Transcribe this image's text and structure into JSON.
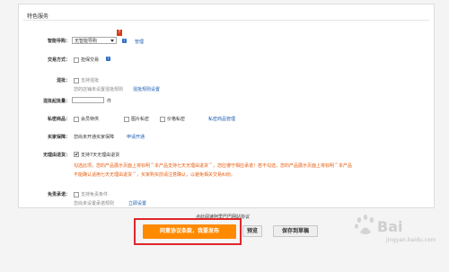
{
  "section": {
    "title": "特色服务"
  },
  "smart_guide": {
    "label": "智能导购：",
    "select_value": "无智能导购",
    "badge": "?",
    "manage_link": "管理"
  },
  "delivery": {
    "label": "交易方式：",
    "option": "担保交易"
  },
  "exchange": {
    "label": "混批：",
    "option": "支持混批",
    "note": "您的店铺未设置混批规则",
    "link": "混批规则设置"
  },
  "min_qty": {
    "label": "混批起批量：",
    "unit": "件"
  },
  "private_goods": {
    "label": "私密商品：",
    "options": [
      "会员特供",
      "图片私密",
      "价格私密"
    ],
    "link": "私密商品管理"
  },
  "buyer_protection": {
    "label": "买家保障：",
    "note": "您尚未开通买家保障",
    "link": "申请开通"
  },
  "no_reason": {
    "label": "无理由退货：",
    "option": "支持7天无理由退货",
    "warning_lines": [
      "勾选此项，您的产品展示页面上将标明＂本产品支持七天无理由退货＂，您应遵守相应承诺！若不勾选，您的产品展示页面上将标明＂本产品",
      "不能确认适用七天无理由退货＂，买家购买前请注意确认，以避免相关交易纠纷。"
    ]
  },
  "free_shipping": {
    "label": "免责承诺：",
    "option": "支持免责条件",
    "note": "您尚未设置承诺规则",
    "link": "立即设置"
  },
  "footer": {
    "agreement": "点此阅读阿里巴巴网站协议",
    "primary_button": "同意协议条款，我要发布",
    "preview_button": "预览",
    "draft_button": "保存到草稿"
  },
  "watermark": {
    "text": "Bai",
    "subtext": "jingyan.baidu.com"
  }
}
